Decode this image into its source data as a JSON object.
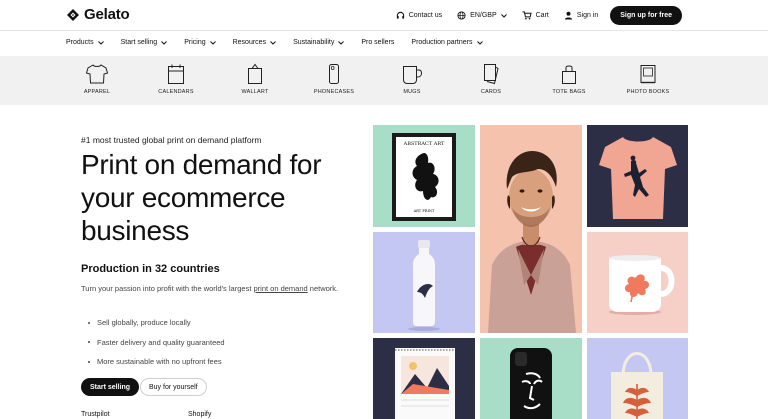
{
  "brand": {
    "name": "Gelato"
  },
  "top_bar": {
    "contact_label": "Contact us",
    "locale_label": "EN/GBP",
    "cart_label": "Cart",
    "signin_label": "Sign in",
    "signup_label": "Sign up for free"
  },
  "main_nav": {
    "items": [
      {
        "label": "Products",
        "has_dropdown": true
      },
      {
        "label": "Start selling",
        "has_dropdown": true
      },
      {
        "label": "Pricing",
        "has_dropdown": true
      },
      {
        "label": "Resources",
        "has_dropdown": true
      },
      {
        "label": "Sustainability",
        "has_dropdown": true
      },
      {
        "label": "Pro sellers",
        "has_dropdown": false
      },
      {
        "label": "Production partners",
        "has_dropdown": true
      }
    ]
  },
  "categories": [
    {
      "label": "APPAREL",
      "icon": "tshirt-icon"
    },
    {
      "label": "CALENDARS",
      "icon": "calendar-icon"
    },
    {
      "label": "WALLART",
      "icon": "wallart-icon"
    },
    {
      "label": "PHONECASES",
      "icon": "phonecase-icon"
    },
    {
      "label": "MUGS",
      "icon": "mug-icon"
    },
    {
      "label": "CARDS",
      "icon": "cards-icon"
    },
    {
      "label": "TOTE BAGS",
      "icon": "totebag-icon"
    },
    {
      "label": "PHOTO BOOKS",
      "icon": "photobook-icon"
    }
  ],
  "hero": {
    "eyebrow": "#1 most trusted global print on demand platform",
    "headline": "Print on demand for your ecommerce business",
    "subhead": "Production in 32 countries",
    "description_prefix": "Turn your passion into profit with the world's largest ",
    "description_link": "print on demand",
    "description_suffix": " network.",
    "bullets": [
      "Sell globally, produce locally",
      "Faster delivery and quality guaranteed",
      "More sustainable with no upfront fees"
    ],
    "primary_cta": "Start selling",
    "secondary_cta": "Buy for yourself",
    "trust_labels": [
      "Trustpilot",
      "Shopify"
    ]
  },
  "gallery": {
    "poster_title": "ABSTRACT ART",
    "poster_caption": "ART PRINT",
    "colors": {
      "mint": "#a8ddc8",
      "peach": "#f4c2ad",
      "navy": "#2b2e45",
      "lavender": "#c4c7f2",
      "pink": "#f6cfc7"
    }
  }
}
